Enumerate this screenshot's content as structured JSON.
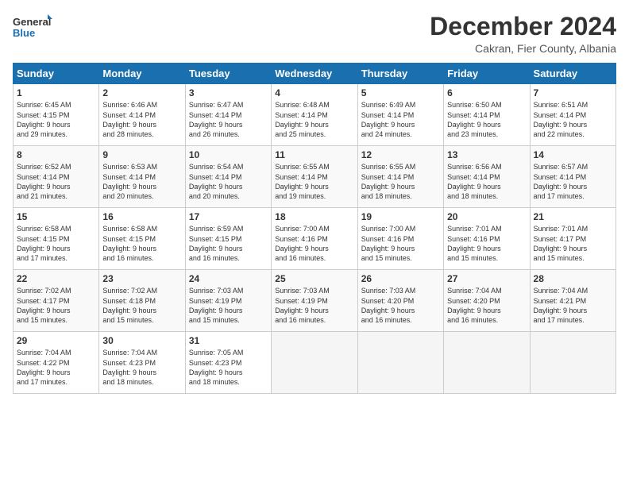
{
  "logo": {
    "line1": "General",
    "line2": "Blue"
  },
  "title": "December 2024",
  "subtitle": "Cakran, Fier County, Albania",
  "days_header": [
    "Sunday",
    "Monday",
    "Tuesday",
    "Wednesday",
    "Thursday",
    "Friday",
    "Saturday"
  ],
  "weeks": [
    [
      {
        "day": 1,
        "lines": [
          "Sunrise: 6:45 AM",
          "Sunset: 4:15 PM",
          "Daylight: 9 hours",
          "and 29 minutes."
        ]
      },
      {
        "day": 2,
        "lines": [
          "Sunrise: 6:46 AM",
          "Sunset: 4:14 PM",
          "Daylight: 9 hours",
          "and 28 minutes."
        ]
      },
      {
        "day": 3,
        "lines": [
          "Sunrise: 6:47 AM",
          "Sunset: 4:14 PM",
          "Daylight: 9 hours",
          "and 26 minutes."
        ]
      },
      {
        "day": 4,
        "lines": [
          "Sunrise: 6:48 AM",
          "Sunset: 4:14 PM",
          "Daylight: 9 hours",
          "and 25 minutes."
        ]
      },
      {
        "day": 5,
        "lines": [
          "Sunrise: 6:49 AM",
          "Sunset: 4:14 PM",
          "Daylight: 9 hours",
          "and 24 minutes."
        ]
      },
      {
        "day": 6,
        "lines": [
          "Sunrise: 6:50 AM",
          "Sunset: 4:14 PM",
          "Daylight: 9 hours",
          "and 23 minutes."
        ]
      },
      {
        "day": 7,
        "lines": [
          "Sunrise: 6:51 AM",
          "Sunset: 4:14 PM",
          "Daylight: 9 hours",
          "and 22 minutes."
        ]
      }
    ],
    [
      {
        "day": 8,
        "lines": [
          "Sunrise: 6:52 AM",
          "Sunset: 4:14 PM",
          "Daylight: 9 hours",
          "and 21 minutes."
        ]
      },
      {
        "day": 9,
        "lines": [
          "Sunrise: 6:53 AM",
          "Sunset: 4:14 PM",
          "Daylight: 9 hours",
          "and 20 minutes."
        ]
      },
      {
        "day": 10,
        "lines": [
          "Sunrise: 6:54 AM",
          "Sunset: 4:14 PM",
          "Daylight: 9 hours",
          "and 20 minutes."
        ]
      },
      {
        "day": 11,
        "lines": [
          "Sunrise: 6:55 AM",
          "Sunset: 4:14 PM",
          "Daylight: 9 hours",
          "and 19 minutes."
        ]
      },
      {
        "day": 12,
        "lines": [
          "Sunrise: 6:55 AM",
          "Sunset: 4:14 PM",
          "Daylight: 9 hours",
          "and 18 minutes."
        ]
      },
      {
        "day": 13,
        "lines": [
          "Sunrise: 6:56 AM",
          "Sunset: 4:14 PM",
          "Daylight: 9 hours",
          "and 18 minutes."
        ]
      },
      {
        "day": 14,
        "lines": [
          "Sunrise: 6:57 AM",
          "Sunset: 4:14 PM",
          "Daylight: 9 hours",
          "and 17 minutes."
        ]
      }
    ],
    [
      {
        "day": 15,
        "lines": [
          "Sunrise: 6:58 AM",
          "Sunset: 4:15 PM",
          "Daylight: 9 hours",
          "and 17 minutes."
        ]
      },
      {
        "day": 16,
        "lines": [
          "Sunrise: 6:58 AM",
          "Sunset: 4:15 PM",
          "Daylight: 9 hours",
          "and 16 minutes."
        ]
      },
      {
        "day": 17,
        "lines": [
          "Sunrise: 6:59 AM",
          "Sunset: 4:15 PM",
          "Daylight: 9 hours",
          "and 16 minutes."
        ]
      },
      {
        "day": 18,
        "lines": [
          "Sunrise: 7:00 AM",
          "Sunset: 4:16 PM",
          "Daylight: 9 hours",
          "and 16 minutes."
        ]
      },
      {
        "day": 19,
        "lines": [
          "Sunrise: 7:00 AM",
          "Sunset: 4:16 PM",
          "Daylight: 9 hours",
          "and 15 minutes."
        ]
      },
      {
        "day": 20,
        "lines": [
          "Sunrise: 7:01 AM",
          "Sunset: 4:16 PM",
          "Daylight: 9 hours",
          "and 15 minutes."
        ]
      },
      {
        "day": 21,
        "lines": [
          "Sunrise: 7:01 AM",
          "Sunset: 4:17 PM",
          "Daylight: 9 hours",
          "and 15 minutes."
        ]
      }
    ],
    [
      {
        "day": 22,
        "lines": [
          "Sunrise: 7:02 AM",
          "Sunset: 4:17 PM",
          "Daylight: 9 hours",
          "and 15 minutes."
        ]
      },
      {
        "day": 23,
        "lines": [
          "Sunrise: 7:02 AM",
          "Sunset: 4:18 PM",
          "Daylight: 9 hours",
          "and 15 minutes."
        ]
      },
      {
        "day": 24,
        "lines": [
          "Sunrise: 7:03 AM",
          "Sunset: 4:19 PM",
          "Daylight: 9 hours",
          "and 15 minutes."
        ]
      },
      {
        "day": 25,
        "lines": [
          "Sunrise: 7:03 AM",
          "Sunset: 4:19 PM",
          "Daylight: 9 hours",
          "and 16 minutes."
        ]
      },
      {
        "day": 26,
        "lines": [
          "Sunrise: 7:03 AM",
          "Sunset: 4:20 PM",
          "Daylight: 9 hours",
          "and 16 minutes."
        ]
      },
      {
        "day": 27,
        "lines": [
          "Sunrise: 7:04 AM",
          "Sunset: 4:20 PM",
          "Daylight: 9 hours",
          "and 16 minutes."
        ]
      },
      {
        "day": 28,
        "lines": [
          "Sunrise: 7:04 AM",
          "Sunset: 4:21 PM",
          "Daylight: 9 hours",
          "and 17 minutes."
        ]
      }
    ],
    [
      {
        "day": 29,
        "lines": [
          "Sunrise: 7:04 AM",
          "Sunset: 4:22 PM",
          "Daylight: 9 hours",
          "and 17 minutes."
        ]
      },
      {
        "day": 30,
        "lines": [
          "Sunrise: 7:04 AM",
          "Sunset: 4:23 PM",
          "Daylight: 9 hours",
          "and 18 minutes."
        ]
      },
      {
        "day": 31,
        "lines": [
          "Sunrise: 7:05 AM",
          "Sunset: 4:23 PM",
          "Daylight: 9 hours",
          "and 18 minutes."
        ]
      },
      null,
      null,
      null,
      null
    ]
  ]
}
